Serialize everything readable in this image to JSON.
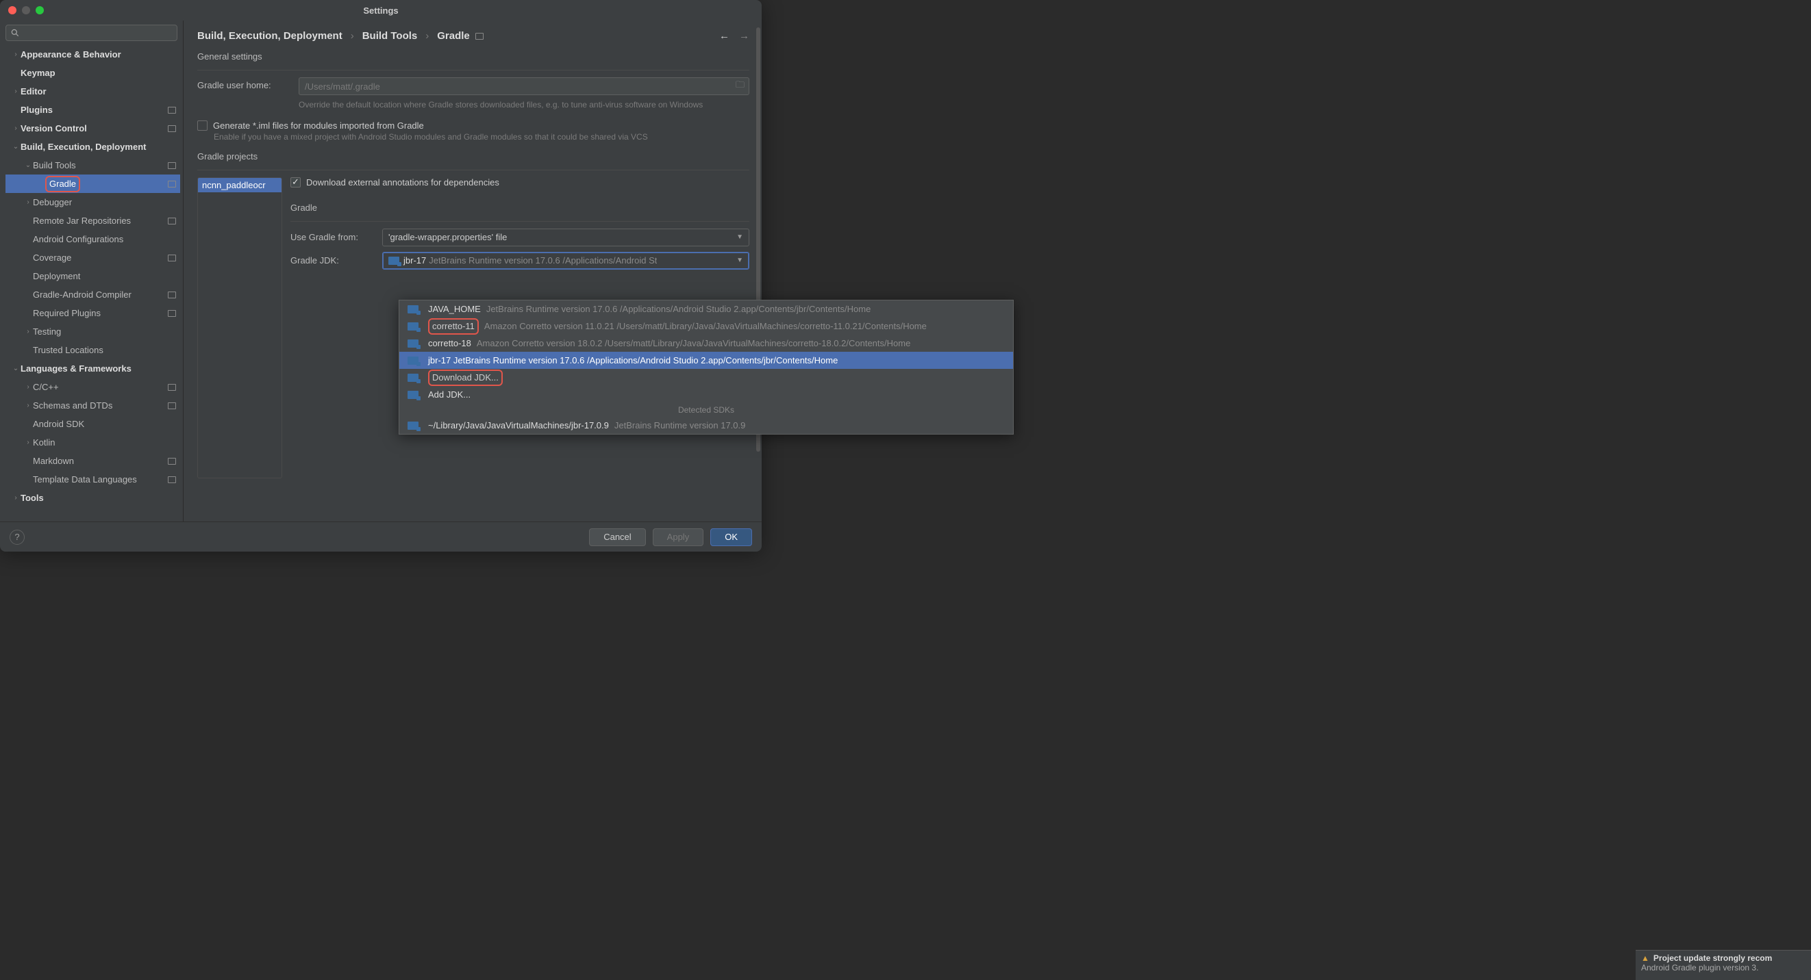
{
  "window": {
    "title": "Settings"
  },
  "breadcrumb": {
    "a": "Build, Execution, Deployment",
    "b": "Build Tools",
    "c": "Gradle"
  },
  "nav_back_enabled": true,
  "sidebar": {
    "search_placeholder": "",
    "items": [
      {
        "label": "Appearance & Behavior",
        "indent": 0,
        "chev": "›",
        "bold": true
      },
      {
        "label": "Keymap",
        "indent": 0,
        "chev": "",
        "bold": true
      },
      {
        "label": "Editor",
        "indent": 0,
        "chev": "›",
        "bold": true
      },
      {
        "label": "Plugins",
        "indent": 0,
        "chev": "",
        "bold": true,
        "badge": true
      },
      {
        "label": "Version Control",
        "indent": 0,
        "chev": "›",
        "bold": true,
        "badge": true
      },
      {
        "label": "Build, Execution, Deployment",
        "indent": 0,
        "chev": "⌄",
        "bold": true
      },
      {
        "label": "Build Tools",
        "indent": 1,
        "chev": "⌄",
        "badge": true
      },
      {
        "label": "Gradle",
        "indent": 2,
        "chev": "",
        "badge": true,
        "selected": true,
        "highlight": true
      },
      {
        "label": "Debugger",
        "indent": 1,
        "chev": "›"
      },
      {
        "label": "Remote Jar Repositories",
        "indent": 1,
        "chev": "",
        "badge": true
      },
      {
        "label": "Android Configurations",
        "indent": 1,
        "chev": ""
      },
      {
        "label": "Coverage",
        "indent": 1,
        "chev": "",
        "badge": true
      },
      {
        "label": "Deployment",
        "indent": 1,
        "chev": ""
      },
      {
        "label": "Gradle-Android Compiler",
        "indent": 1,
        "chev": "",
        "badge": true
      },
      {
        "label": "Required Plugins",
        "indent": 1,
        "chev": "",
        "badge": true
      },
      {
        "label": "Testing",
        "indent": 1,
        "chev": "›"
      },
      {
        "label": "Trusted Locations",
        "indent": 1,
        "chev": ""
      },
      {
        "label": "Languages & Frameworks",
        "indent": 0,
        "chev": "⌄",
        "bold": true
      },
      {
        "label": "C/C++",
        "indent": 1,
        "chev": "›",
        "badge": true
      },
      {
        "label": "Schemas and DTDs",
        "indent": 1,
        "chev": "›",
        "badge": true
      },
      {
        "label": "Android SDK",
        "indent": 1,
        "chev": ""
      },
      {
        "label": "Kotlin",
        "indent": 1,
        "chev": "›"
      },
      {
        "label": "Markdown",
        "indent": 1,
        "chev": "",
        "badge": true
      },
      {
        "label": "Template Data Languages",
        "indent": 1,
        "chev": "",
        "badge": true
      },
      {
        "label": "Tools",
        "indent": 0,
        "chev": "›",
        "bold": true
      }
    ]
  },
  "general": {
    "title": "General settings",
    "home_label": "Gradle user home:",
    "home_placeholder": "/Users/matt/.gradle",
    "home_hint": "Override the default location where Gradle stores downloaded files, e.g. to tune anti-virus software on Windows",
    "iml_label": "Generate *.iml files for modules imported from Gradle",
    "iml_hint": "Enable if you have a mixed project with Android Studio modules and Gradle modules so that it could be shared via VCS"
  },
  "projects": {
    "title": "Gradle projects",
    "item": "ncnn_paddleocr",
    "download_label": "Download external annotations for dependencies",
    "gradle_title": "Gradle",
    "use_from_label": "Use Gradle from:",
    "use_from_value": "'gradle-wrapper.properties' file",
    "jdk_label": "Gradle JDK:",
    "jdk_value_name": "jbr-17",
    "jdk_value_detail": "JetBrains Runtime version 17.0.6 /Applications/Android St"
  },
  "dropdown": {
    "items": [
      {
        "name": "JAVA_HOME",
        "detail": "JetBrains Runtime version 17.0.6 /Applications/Android Studio 2.app/Contents/jbr/Contents/Home"
      },
      {
        "name": "corretto-11",
        "detail": "Amazon Corretto version 11.0.21 /Users/matt/Library/Java/JavaVirtualMachines/corretto-11.0.21/Contents/Home",
        "highlight": true
      },
      {
        "name": "corretto-18",
        "detail": "Amazon Corretto version 18.0.2 /Users/matt/Library/Java/JavaVirtualMachines/corretto-18.0.2/Contents/Home"
      },
      {
        "name": "jbr-17 JetBrains Runtime version 17.0.6 /Applications/Android Studio 2.app/Contents/jbr/Contents/Home",
        "detail": "",
        "selected": true
      },
      {
        "name": "Download JDK...",
        "detail": "",
        "highlight": true
      },
      {
        "name": "Add JDK...",
        "detail": ""
      }
    ],
    "detected_title": "Detected SDKs",
    "detected": {
      "name": "~/Library/Java/JavaVirtualMachines/jbr-17.0.9",
      "detail": "JetBrains Runtime version 17.0.9"
    }
  },
  "footer": {
    "cancel": "Cancel",
    "apply": "Apply",
    "ok": "OK"
  },
  "notification": {
    "title": "Project update strongly recom",
    "body": "Android Gradle plugin version 3."
  }
}
